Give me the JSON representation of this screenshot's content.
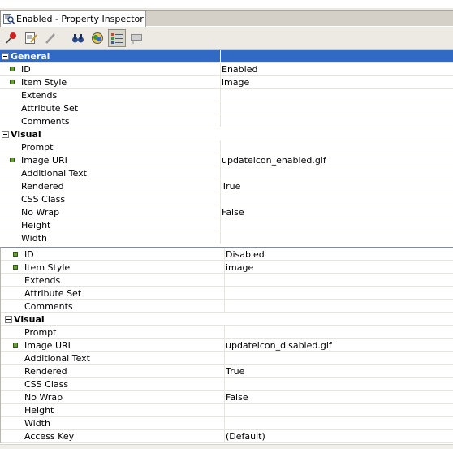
{
  "tab": {
    "title": "Enabled - Property Inspector",
    "icon": "property-inspector-icon"
  },
  "toolbar": {
    "buttons": [
      {
        "name": "pin-icon",
        "color": "#cc2222"
      },
      {
        "name": "edit-properties-icon",
        "color": "#c89a2a"
      },
      {
        "name": "pencil-icon",
        "color": "#999999"
      },
      {
        "name": "find-binoculars-icon",
        "color": "#2a4a8a"
      },
      {
        "name": "color-palette-icon",
        "color": "#2a9a3a"
      },
      {
        "name": "categorized-view-icon",
        "color": "#3a5a9a",
        "active": true
      },
      {
        "name": "description-icon",
        "color": "#8a8a8a"
      }
    ]
  },
  "colors": {
    "selection": "#316ac5",
    "bullet": "#6a9c3a"
  },
  "grid1": {
    "general": {
      "label": "General"
    },
    "general_rows": [
      {
        "label": "ID",
        "value": "Enabled",
        "required": true
      },
      {
        "label": "Item Style",
        "value": "image",
        "required": true
      },
      {
        "label": "Extends",
        "value": ""
      },
      {
        "label": "Attribute Set",
        "value": ""
      },
      {
        "label": "Comments",
        "value": ""
      }
    ],
    "visual": {
      "label": "Visual"
    },
    "visual_rows": [
      {
        "label": "Prompt",
        "value": ""
      },
      {
        "label": "Image URI",
        "value": "updateicon_enabled.gif",
        "required": true
      },
      {
        "label": "Additional Text",
        "value": ""
      },
      {
        "label": "Rendered",
        "value": "True"
      },
      {
        "label": "CSS Class",
        "value": ""
      },
      {
        "label": "No Wrap",
        "value": "False"
      },
      {
        "label": "Height",
        "value": ""
      },
      {
        "label": "Width",
        "value": ""
      }
    ]
  },
  "grid2": {
    "general_rows": [
      {
        "label": "ID",
        "value": "Disabled",
        "required": true
      },
      {
        "label": "Item Style",
        "value": "image",
        "required": true
      },
      {
        "label": "Extends",
        "value": ""
      },
      {
        "label": "Attribute Set",
        "value": ""
      },
      {
        "label": "Comments",
        "value": ""
      }
    ],
    "visual": {
      "label": "Visual"
    },
    "visual_rows": [
      {
        "label": "Prompt",
        "value": ""
      },
      {
        "label": "Image URI",
        "value": "updateicon_disabled.gif",
        "required": true
      },
      {
        "label": "Additional Text",
        "value": ""
      },
      {
        "label": "Rendered",
        "value": "True"
      },
      {
        "label": "CSS Class",
        "value": ""
      },
      {
        "label": "No Wrap",
        "value": "False"
      },
      {
        "label": "Height",
        "value": ""
      },
      {
        "label": "Width",
        "value": ""
      },
      {
        "label": "Access Key",
        "value": "(Default)"
      }
    ]
  }
}
